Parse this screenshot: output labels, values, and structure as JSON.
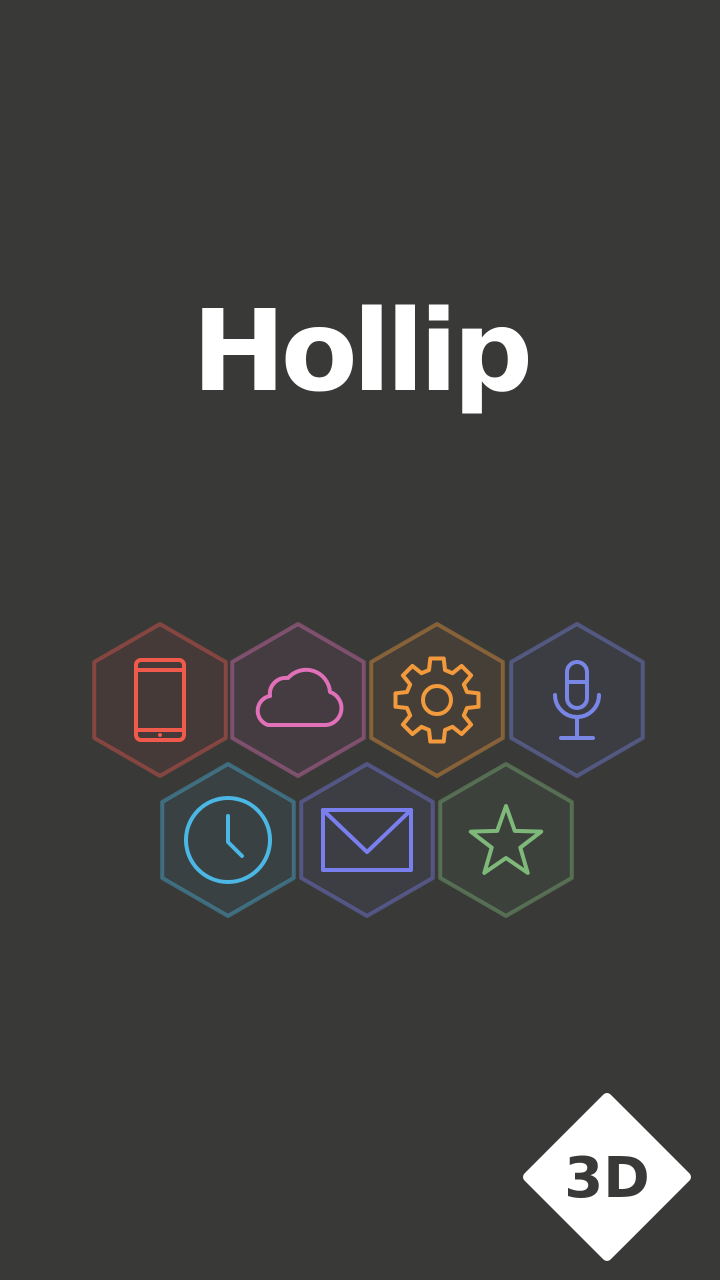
{
  "app": {
    "title": "Hollip",
    "mode_badge": "3D"
  },
  "tiles": [
    {
      "name": "tablet-tile",
      "icon": "tablet-icon",
      "color": "#ef5a4d",
      "row": 1,
      "col": 1
    },
    {
      "name": "cloud-tile",
      "icon": "cloud-icon",
      "color": "#e070b8",
      "row": 1,
      "col": 2
    },
    {
      "name": "settings-tile",
      "icon": "gear-icon",
      "color": "#f39a3c",
      "row": 1,
      "col": 3
    },
    {
      "name": "microphone-tile",
      "icon": "microphone-icon",
      "color": "#7886e6",
      "row": 1,
      "col": 4
    },
    {
      "name": "clock-tile",
      "icon": "clock-icon",
      "color": "#4bb7e4",
      "row": 2,
      "col": 1
    },
    {
      "name": "mail-tile",
      "icon": "mail-icon",
      "color": "#7a7ff0",
      "row": 2,
      "col": 2
    },
    {
      "name": "star-tile",
      "icon": "star-icon",
      "color": "#7fb97a",
      "row": 2,
      "col": 3
    }
  ]
}
